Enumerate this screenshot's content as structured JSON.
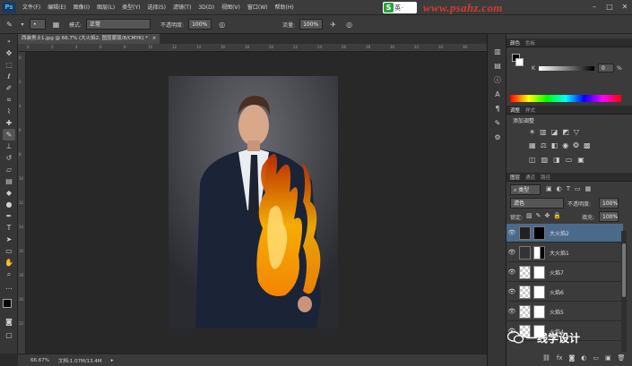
{
  "app": {
    "logo": "Ps"
  },
  "menu": [
    "文件(F)",
    "编辑(E)",
    "图像(I)",
    "图层(L)",
    "类型(Y)",
    "选择(S)",
    "滤镜(T)",
    "3D(D)",
    "视图(V)",
    "窗口(W)",
    "帮助(H)"
  ],
  "watermark": {
    "text": "www.psahz.com",
    "sogou": "英"
  },
  "options": {
    "mode_label": "模式:",
    "mode_value": "正常",
    "opacity_label": "不透明度:",
    "opacity_value": "100%",
    "flow_label": "流量:",
    "flow_value": "100%"
  },
  "document": {
    "tab_title": "西装男士1.jpg @ 66.7% (大火焰2, 图层蒙版/8/CMYK) *"
  },
  "ruler_ticks": [
    "0",
    "2",
    "4",
    "6",
    "8",
    "10",
    "12",
    "14",
    "16",
    "18",
    "20",
    "22",
    "24",
    "26",
    "28",
    "30",
    "32",
    "34",
    "36"
  ],
  "status": {
    "zoom": "66.67%",
    "doc": "文档:1.07M/13.4M"
  },
  "color_panel": {
    "tabs": [
      "颜色",
      "色板"
    ],
    "channel": "K",
    "value": "0",
    "unit": "%"
  },
  "adjust_panel": {
    "tabs": [
      "调整",
      "样式"
    ],
    "title": "添加调整"
  },
  "layers_panel": {
    "tabs": [
      "图层",
      "通道",
      "路径"
    ],
    "filter_label": "类型",
    "blend_mode": "滤色",
    "opacity_label": "不透明度:",
    "opacity_value": "100%",
    "lock_label": "锁定:",
    "fill_label": "填充:",
    "fill_value": "100%",
    "layers": [
      {
        "name": "大火焰2",
        "selected": true
      },
      {
        "name": "大火焰1",
        "selected": false
      },
      {
        "name": "火焰7",
        "selected": false
      },
      {
        "name": "火焰6",
        "selected": false
      },
      {
        "name": "火焰5",
        "selected": false
      },
      {
        "name": "火焰4",
        "selected": false
      }
    ]
  },
  "overlay": {
    "wechat_text": "一线学设计"
  },
  "colors": {
    "accent": "#2f6ea5",
    "selected_layer": "#4b6a8b"
  }
}
